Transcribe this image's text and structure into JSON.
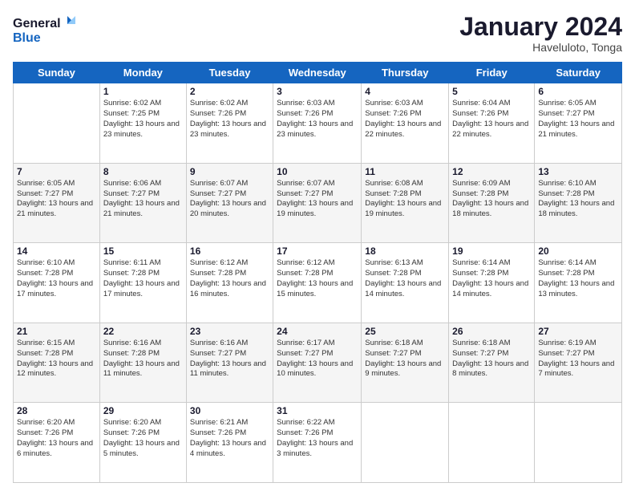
{
  "logo": {
    "line1": "General",
    "line2": "Blue"
  },
  "title": "January 2024",
  "location": "Haveluloto, Tonga",
  "weekdays": [
    "Sunday",
    "Monday",
    "Tuesday",
    "Wednesday",
    "Thursday",
    "Friday",
    "Saturday"
  ],
  "weeks": [
    [
      {
        "day": "",
        "sunrise": "",
        "sunset": "",
        "daylight": ""
      },
      {
        "day": "1",
        "sunrise": "Sunrise: 6:02 AM",
        "sunset": "Sunset: 7:25 PM",
        "daylight": "Daylight: 13 hours and 23 minutes."
      },
      {
        "day": "2",
        "sunrise": "Sunrise: 6:02 AM",
        "sunset": "Sunset: 7:26 PM",
        "daylight": "Daylight: 13 hours and 23 minutes."
      },
      {
        "day": "3",
        "sunrise": "Sunrise: 6:03 AM",
        "sunset": "Sunset: 7:26 PM",
        "daylight": "Daylight: 13 hours and 23 minutes."
      },
      {
        "day": "4",
        "sunrise": "Sunrise: 6:03 AM",
        "sunset": "Sunset: 7:26 PM",
        "daylight": "Daylight: 13 hours and 22 minutes."
      },
      {
        "day": "5",
        "sunrise": "Sunrise: 6:04 AM",
        "sunset": "Sunset: 7:26 PM",
        "daylight": "Daylight: 13 hours and 22 minutes."
      },
      {
        "day": "6",
        "sunrise": "Sunrise: 6:05 AM",
        "sunset": "Sunset: 7:27 PM",
        "daylight": "Daylight: 13 hours and 21 minutes."
      }
    ],
    [
      {
        "day": "7",
        "sunrise": "Sunrise: 6:05 AM",
        "sunset": "Sunset: 7:27 PM",
        "daylight": "Daylight: 13 hours and 21 minutes."
      },
      {
        "day": "8",
        "sunrise": "Sunrise: 6:06 AM",
        "sunset": "Sunset: 7:27 PM",
        "daylight": "Daylight: 13 hours and 21 minutes."
      },
      {
        "day": "9",
        "sunrise": "Sunrise: 6:07 AM",
        "sunset": "Sunset: 7:27 PM",
        "daylight": "Daylight: 13 hours and 20 minutes."
      },
      {
        "day": "10",
        "sunrise": "Sunrise: 6:07 AM",
        "sunset": "Sunset: 7:27 PM",
        "daylight": "Daylight: 13 hours and 19 minutes."
      },
      {
        "day": "11",
        "sunrise": "Sunrise: 6:08 AM",
        "sunset": "Sunset: 7:28 PM",
        "daylight": "Daylight: 13 hours and 19 minutes."
      },
      {
        "day": "12",
        "sunrise": "Sunrise: 6:09 AM",
        "sunset": "Sunset: 7:28 PM",
        "daylight": "Daylight: 13 hours and 18 minutes."
      },
      {
        "day": "13",
        "sunrise": "Sunrise: 6:10 AM",
        "sunset": "Sunset: 7:28 PM",
        "daylight": "Daylight: 13 hours and 18 minutes."
      }
    ],
    [
      {
        "day": "14",
        "sunrise": "Sunrise: 6:10 AM",
        "sunset": "Sunset: 7:28 PM",
        "daylight": "Daylight: 13 hours and 17 minutes."
      },
      {
        "day": "15",
        "sunrise": "Sunrise: 6:11 AM",
        "sunset": "Sunset: 7:28 PM",
        "daylight": "Daylight: 13 hours and 17 minutes."
      },
      {
        "day": "16",
        "sunrise": "Sunrise: 6:12 AM",
        "sunset": "Sunset: 7:28 PM",
        "daylight": "Daylight: 13 hours and 16 minutes."
      },
      {
        "day": "17",
        "sunrise": "Sunrise: 6:12 AM",
        "sunset": "Sunset: 7:28 PM",
        "daylight": "Daylight: 13 hours and 15 minutes."
      },
      {
        "day": "18",
        "sunrise": "Sunrise: 6:13 AM",
        "sunset": "Sunset: 7:28 PM",
        "daylight": "Daylight: 13 hours and 14 minutes."
      },
      {
        "day": "19",
        "sunrise": "Sunrise: 6:14 AM",
        "sunset": "Sunset: 7:28 PM",
        "daylight": "Daylight: 13 hours and 14 minutes."
      },
      {
        "day": "20",
        "sunrise": "Sunrise: 6:14 AM",
        "sunset": "Sunset: 7:28 PM",
        "daylight": "Daylight: 13 hours and 13 minutes."
      }
    ],
    [
      {
        "day": "21",
        "sunrise": "Sunrise: 6:15 AM",
        "sunset": "Sunset: 7:28 PM",
        "daylight": "Daylight: 13 hours and 12 minutes."
      },
      {
        "day": "22",
        "sunrise": "Sunrise: 6:16 AM",
        "sunset": "Sunset: 7:28 PM",
        "daylight": "Daylight: 13 hours and 11 minutes."
      },
      {
        "day": "23",
        "sunrise": "Sunrise: 6:16 AM",
        "sunset": "Sunset: 7:27 PM",
        "daylight": "Daylight: 13 hours and 11 minutes."
      },
      {
        "day": "24",
        "sunrise": "Sunrise: 6:17 AM",
        "sunset": "Sunset: 7:27 PM",
        "daylight": "Daylight: 13 hours and 10 minutes."
      },
      {
        "day": "25",
        "sunrise": "Sunrise: 6:18 AM",
        "sunset": "Sunset: 7:27 PM",
        "daylight": "Daylight: 13 hours and 9 minutes."
      },
      {
        "day": "26",
        "sunrise": "Sunrise: 6:18 AM",
        "sunset": "Sunset: 7:27 PM",
        "daylight": "Daylight: 13 hours and 8 minutes."
      },
      {
        "day": "27",
        "sunrise": "Sunrise: 6:19 AM",
        "sunset": "Sunset: 7:27 PM",
        "daylight": "Daylight: 13 hours and 7 minutes."
      }
    ],
    [
      {
        "day": "28",
        "sunrise": "Sunrise: 6:20 AM",
        "sunset": "Sunset: 7:26 PM",
        "daylight": "Daylight: 13 hours and 6 minutes."
      },
      {
        "day": "29",
        "sunrise": "Sunrise: 6:20 AM",
        "sunset": "Sunset: 7:26 PM",
        "daylight": "Daylight: 13 hours and 5 minutes."
      },
      {
        "day": "30",
        "sunrise": "Sunrise: 6:21 AM",
        "sunset": "Sunset: 7:26 PM",
        "daylight": "Daylight: 13 hours and 4 minutes."
      },
      {
        "day": "31",
        "sunrise": "Sunrise: 6:22 AM",
        "sunset": "Sunset: 7:26 PM",
        "daylight": "Daylight: 13 hours and 3 minutes."
      },
      {
        "day": "",
        "sunrise": "",
        "sunset": "",
        "daylight": ""
      },
      {
        "day": "",
        "sunrise": "",
        "sunset": "",
        "daylight": ""
      },
      {
        "day": "",
        "sunrise": "",
        "sunset": "",
        "daylight": ""
      }
    ]
  ]
}
